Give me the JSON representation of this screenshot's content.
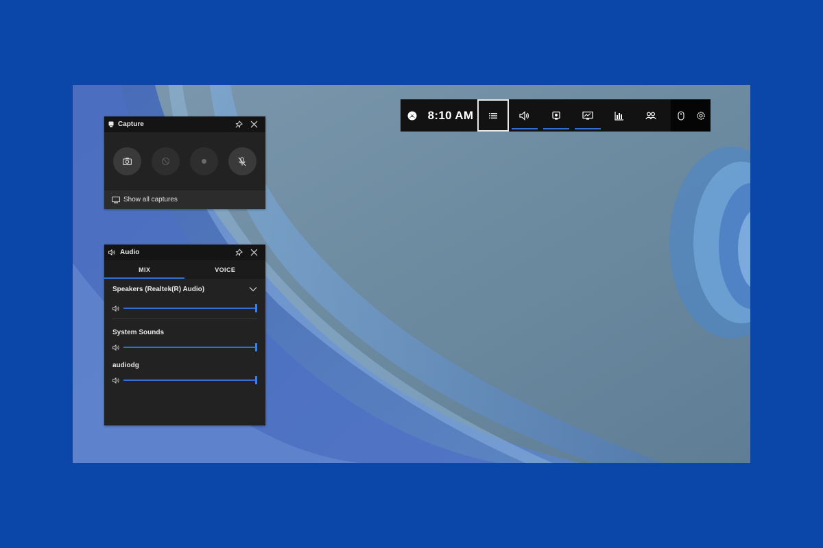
{
  "gamebar": {
    "time": "8:10 AM",
    "icons": [
      "xbox-icon",
      "widget-menu-icon",
      "audio-icon",
      "capture-icon",
      "performance-icon",
      "resources-icon",
      "xbox-social-icon",
      "mouse-icon",
      "settings-icon"
    ]
  },
  "capture": {
    "title": "Capture",
    "footer": "Show all captures",
    "buttons": [
      "screenshot",
      "record-last-30s",
      "start-recording",
      "mic-off"
    ]
  },
  "audio": {
    "title": "Audio",
    "tabs": [
      "MIX",
      "VOICE"
    ],
    "active_tab": "MIX",
    "device": "Speakers (Realtek(R) Audio)",
    "device_volume": 100,
    "apps": [
      {
        "name": "System Sounds",
        "volume": 100
      },
      {
        "name": "audiodg",
        "volume": 100
      }
    ]
  },
  "colors": {
    "background": "#0a47a8",
    "panel": "#222222",
    "accent": "#2f6fd3"
  }
}
